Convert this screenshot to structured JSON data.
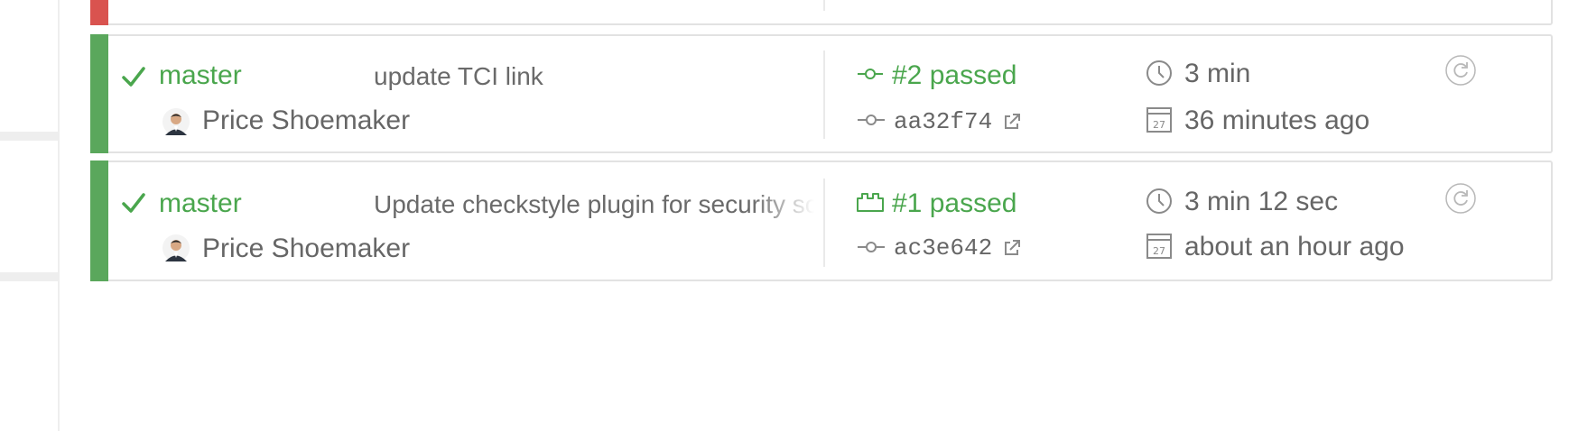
{
  "colors": {
    "passed": "#5aa75c",
    "failed": "#d9534f",
    "text": "#666666",
    "link_green": "#4aa64d"
  },
  "builds": [
    {
      "status": "passed",
      "branch": "master",
      "message": "update TCI link",
      "author": "Price Shoemaker",
      "build_label": "#2 passed",
      "build_icon": "commit-icon",
      "commit": "aa32f74",
      "duration": "3 min",
      "finished": "36 minutes ago"
    },
    {
      "status": "passed",
      "branch": "master",
      "message": "Update checkstyle plugin for security scanning",
      "author": "Price Shoemaker",
      "build_label": "#1 passed",
      "build_icon": "push-icon",
      "commit": "ac3e642",
      "duration": "3 min 12 sec",
      "finished": "about an hour ago"
    }
  ],
  "icons": {
    "check": "check-icon",
    "avatar": "avatar",
    "clock": "clock-icon",
    "calendar": "calendar-icon",
    "external": "external-link-icon",
    "restart": "restart-icon"
  }
}
